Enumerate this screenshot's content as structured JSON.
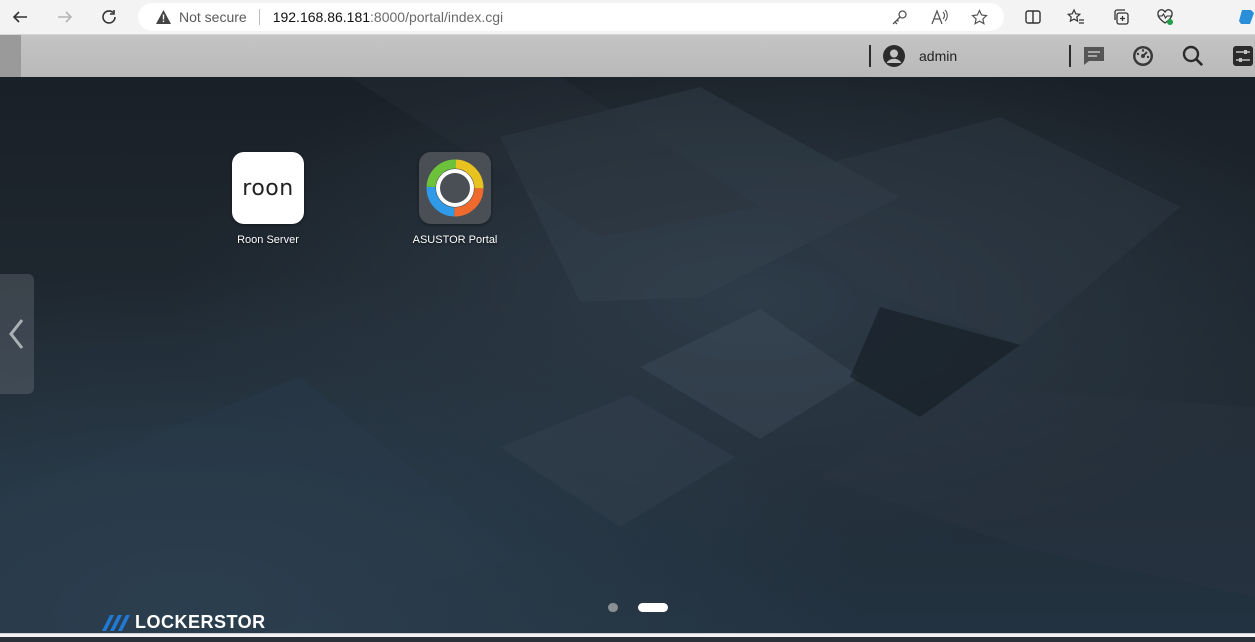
{
  "browser": {
    "security_label": "Not secure",
    "url_host": "192.168.86.181",
    "url_rest": ":8000/portal/index.cgi"
  },
  "topbar": {
    "username": "admin",
    "icons": [
      "user-icon",
      "message-icon",
      "dashboard-icon",
      "search-icon",
      "settings-sliders-icon"
    ]
  },
  "apps": [
    {
      "label": "Roon Server",
      "icon_text": "roon",
      "icon": "roon-icon"
    },
    {
      "label": "ASUSTOR Portal",
      "icon": "asustor-portal-icon"
    }
  ],
  "pager": {
    "pages": 2,
    "active_page": 2
  },
  "brand": {
    "text": "LOCKERSTOR"
  },
  "colors": {
    "accent_blue": "#1f7ad6",
    "desktop_bg": "#1c242c",
    "topbar": "#bfbfbf"
  }
}
